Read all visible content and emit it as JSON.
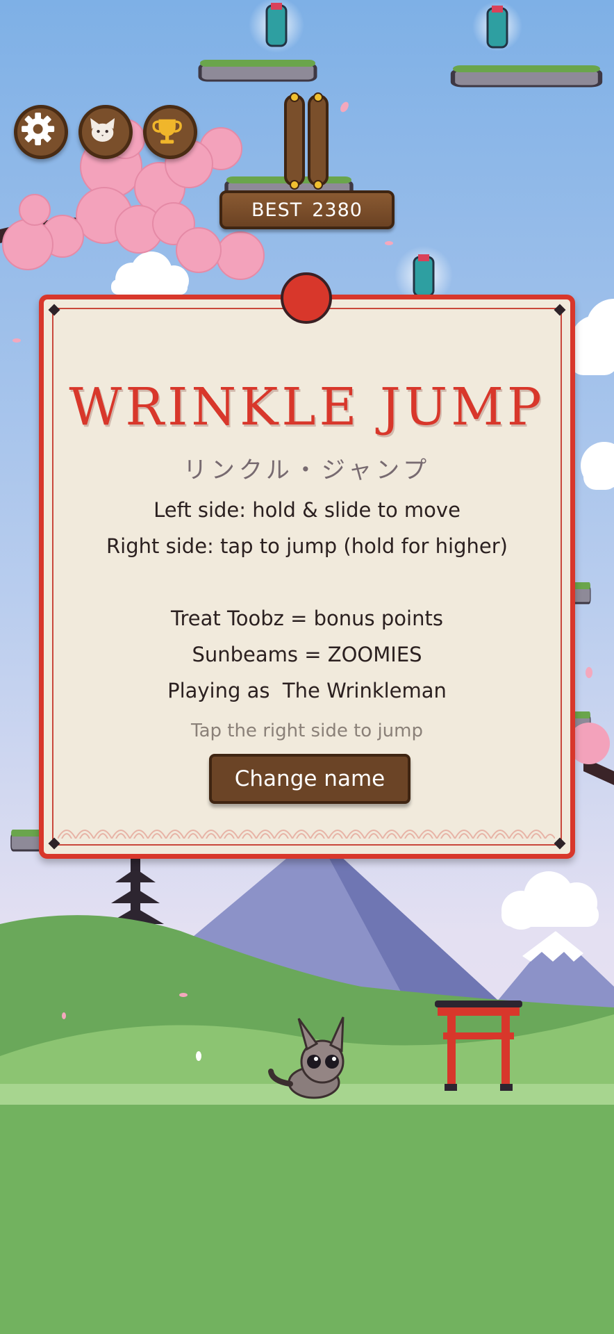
{
  "hud": {
    "settings_icon": "gear-icon",
    "character_icon": "cat-face-icon",
    "trophy_icon": "trophy-icon",
    "pause_icon": "pause-icon",
    "best_label": "BEST",
    "best_score": "2380"
  },
  "panel": {
    "title": "WRINKLE JUMP",
    "subtitle": "リンクル・ジャンプ",
    "lines": [
      "Left side: hold & slide to move",
      "Right side: tap to jump (hold for higher)",
      "Treat Toobz = bonus points",
      "Sunbeams = ZOOMIES",
      "Playing as  The Wrinkleman"
    ],
    "hint": "Tap the right side to jump",
    "change_name_button": "Change name"
  },
  "colors": {
    "accent_red": "#d8372b",
    "wood_brown": "#6b4426",
    "panel_paper": "#f1eadc",
    "sky_top": "#7fb1e6",
    "grass": "#6fae5e"
  }
}
